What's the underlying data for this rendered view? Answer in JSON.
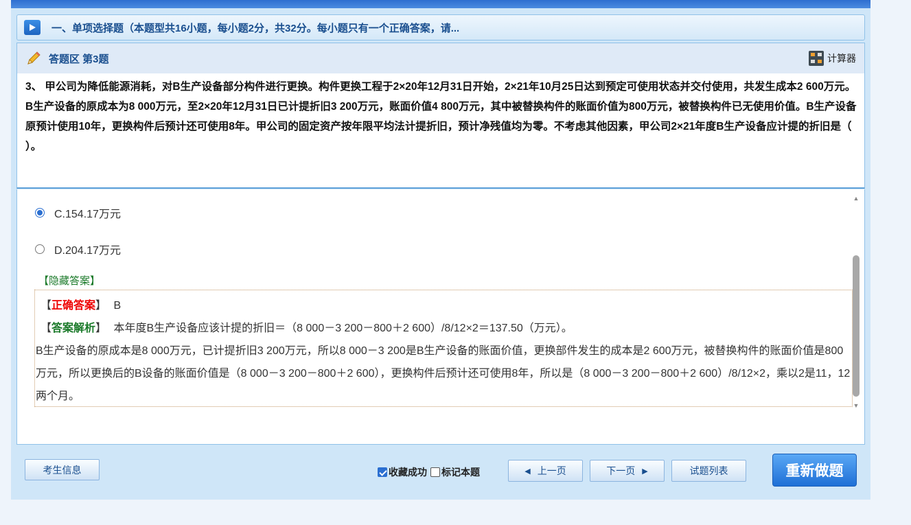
{
  "section": {
    "title": "一、单项选择题（本题型共16小题，每小题2分，共32分。每小题只有一个正确答案，请..."
  },
  "question": {
    "area_title": "答题区 第3题",
    "calculator_label": "计算器",
    "text": "3、 甲公司为降低能源消耗，对B生产设备部分构件进行更换。构件更换工程于2×20年12月31日开始，2×21年10月25日达到预定可使用状态并交付使用，共发生成本2 600万元。B生产设备的原成本为8 000万元，至2×20年12月31日已计提折旧3 200万元，账面价值4 800万元，其中被替换构件的账面价值为800万元，被替换构件已无使用价值。B生产设备原预计使用10年，更换构件后预计还可使用8年。甲公司的固定资产按年限平均法计提折旧，预计净残值均为零。不考虑其他因素，甲公司2×21年度B生产设备应计提的折旧是（    ）。"
  },
  "options": [
    {
      "label": "C.154.17万元",
      "selected": true
    },
    {
      "label": "D.204.17万元",
      "selected": false
    }
  ],
  "answer": {
    "hide_label": "【隐藏答案】",
    "correct_tag": "【正确答案】",
    "correct_tag_open": "【",
    "correct_tag_text": "正确答案",
    "correct_tag_close": "】",
    "correct_value": "B",
    "analysis_tag_open": "【",
    "analysis_tag_text": "答案解析",
    "analysis_tag_close": "】",
    "analysis_line1": "本年度B生产设备应该计提的折旧＝（8 000－3 200－800＋2 600）/8/12×2＝137.50（万元）。",
    "analysis_line2": "B生产设备的原成本是8 000万元，已计提折旧3 200万元，所以8 000－3 200是B生产设备的账面价值，更换部件发生的成本是2 600万元，被替换构件的账面价值是800万元，所以更换后的B设备的账面价值是（8 000－3 200－800＋2 600），更换构件后预计还可使用8年，所以是（8 000－3 200－800＋2 600）/8/12×2，乘以2是11，12两个月。"
  },
  "footer": {
    "candidate_info": "考生信息",
    "favorite_label": "收藏成功",
    "favorite_checked": true,
    "mark_label": "标记本题",
    "mark_checked": false,
    "prev_label": "上一页",
    "next_label": "下一页",
    "list_label": "试题列表",
    "redo_label": "重新做题"
  }
}
